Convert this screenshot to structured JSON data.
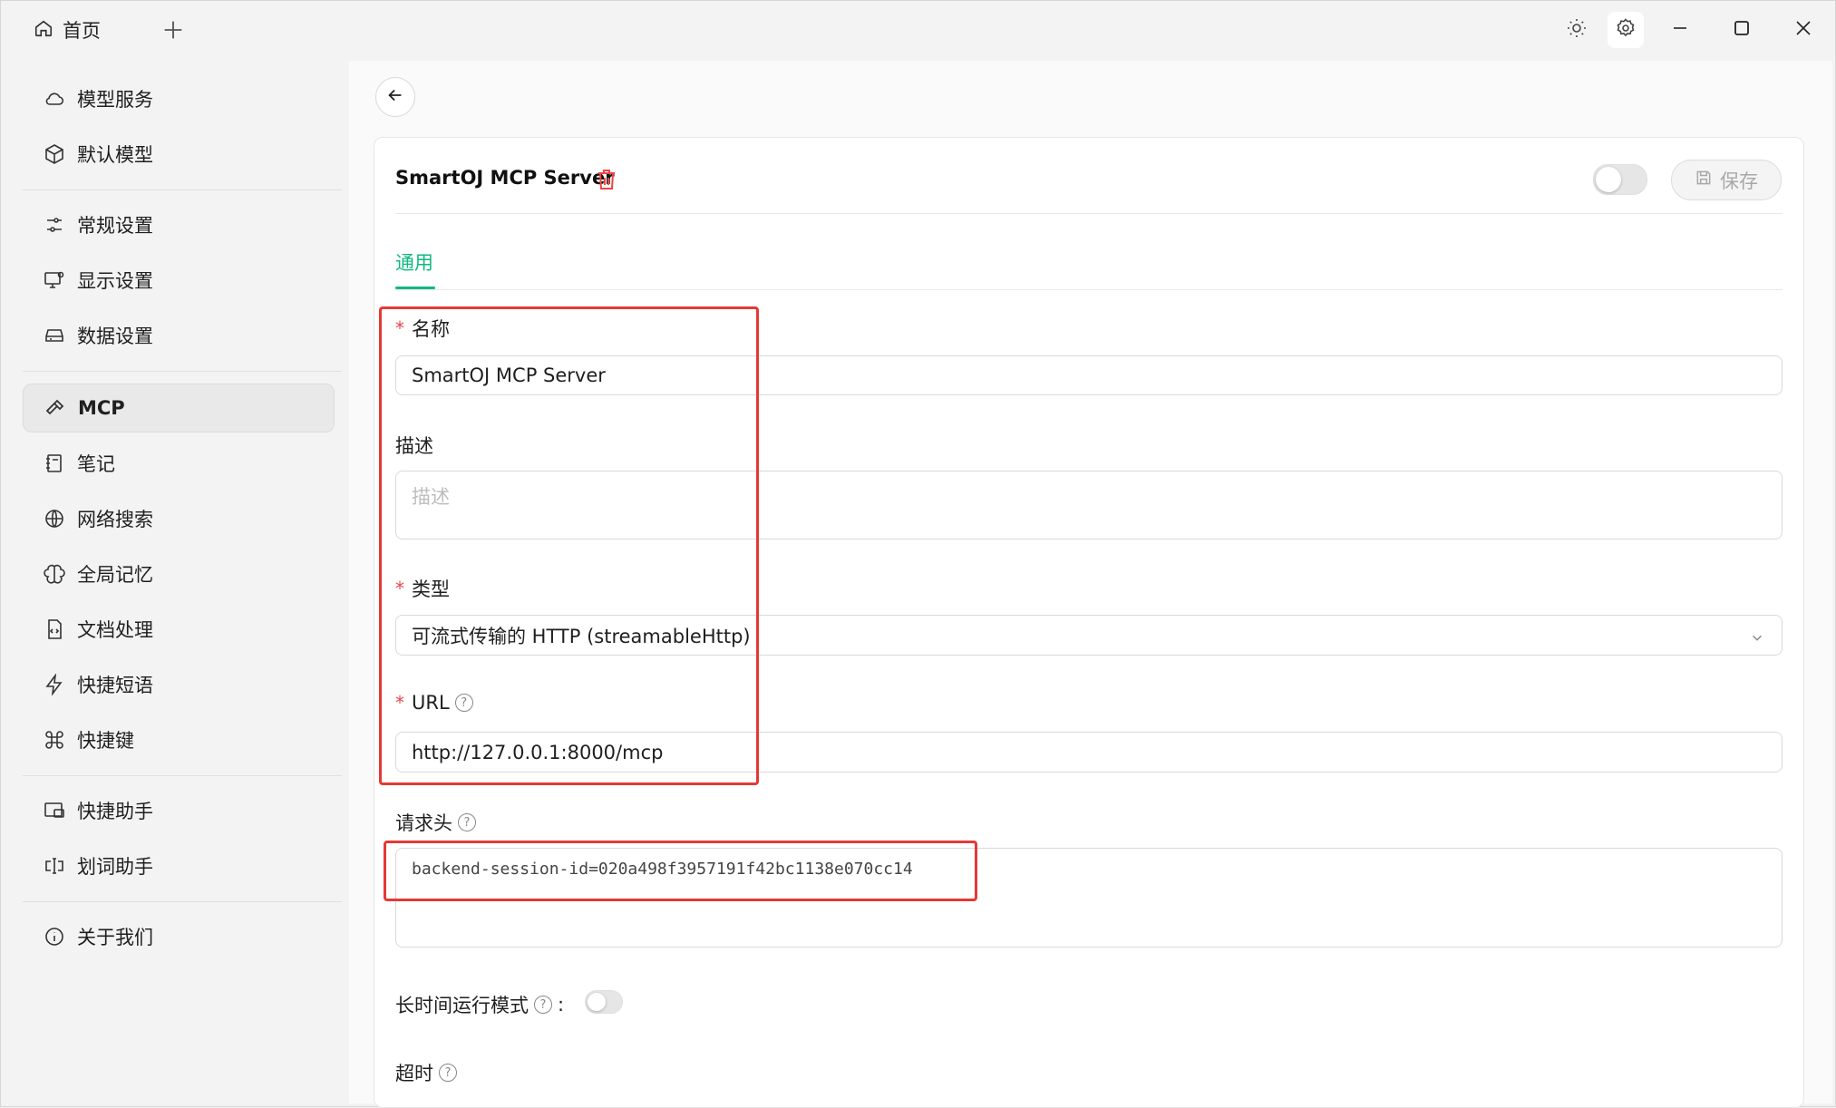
{
  "titlebar": {
    "home_tab": "首页",
    "add_tab_icon": "plus-icon",
    "controls": [
      "sun-icon",
      "gear-icon",
      "minimize-icon",
      "maximize-icon",
      "close-icon"
    ]
  },
  "sidebar": {
    "items": [
      {
        "label": "模型服务",
        "icon": "cloud-icon"
      },
      {
        "label": "默认模型",
        "icon": "cube-icon"
      },
      {
        "label": "常规设置",
        "icon": "sliders-icon"
      },
      {
        "label": "显示设置",
        "icon": "monitor-settings-icon"
      },
      {
        "label": "数据设置",
        "icon": "drive-icon"
      },
      {
        "label": "MCP",
        "icon": "hammer-icon",
        "active": true
      },
      {
        "label": "笔记",
        "icon": "notebook-icon"
      },
      {
        "label": "网络搜索",
        "icon": "globe-icon"
      },
      {
        "label": "全局记忆",
        "icon": "brain-icon"
      },
      {
        "label": "文档处理",
        "icon": "file-code-icon"
      },
      {
        "label": "快捷短语",
        "icon": "lightning-icon"
      },
      {
        "label": "快捷键",
        "icon": "command-icon"
      },
      {
        "label": "快捷助手",
        "icon": "window-assistant-icon"
      },
      {
        "label": "划词助手",
        "icon": "text-cursor-icon"
      },
      {
        "label": "关于我们",
        "icon": "info-icon"
      }
    ]
  },
  "server": {
    "title": "SmartOJ MCP Server",
    "save_label": "保存",
    "tab_general": "通用"
  },
  "form": {
    "name_label": "名称",
    "name_value": "SmartOJ MCP Server",
    "desc_label": "描述",
    "desc_placeholder": "描述",
    "type_label": "类型",
    "type_value": "可流式传输的 HTTP (streamableHttp)",
    "url_label": "URL",
    "url_value": "http://127.0.0.1:8000/mcp",
    "headers_label": "请求头",
    "headers_value": "backend-session-id=020a498f3957191f42bc1138e070cc14",
    "long_running_label": "长时间运行模式",
    "long_running_colon": ":",
    "timeout_label": "超时",
    "required_mark": "*",
    "help_mark": "?"
  },
  "colors": {
    "accent": "#10b981",
    "danger": "#ef4444",
    "highlight_box": "#e53935"
  }
}
